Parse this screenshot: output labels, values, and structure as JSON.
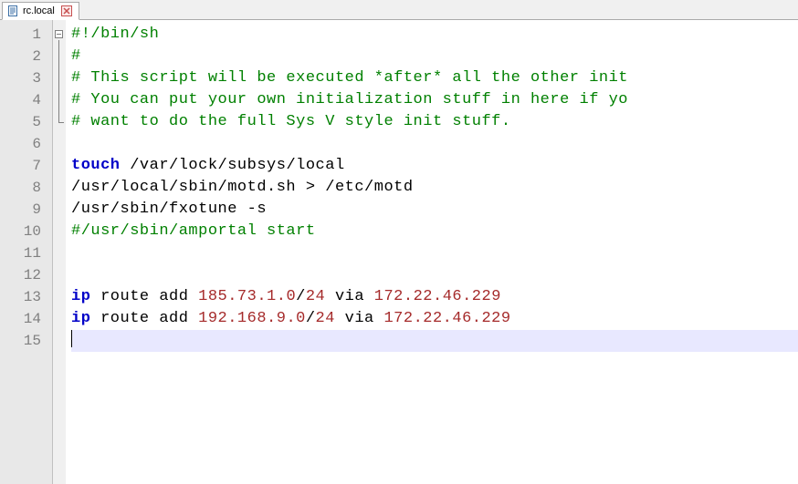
{
  "tab": {
    "filename": "rc.local"
  },
  "gutter": {
    "count": 15
  },
  "fold": {
    "start": 1,
    "end": 5
  },
  "code": {
    "lines": [
      [
        {
          "cls": "t-comment",
          "txt": "#!/bin/sh"
        }
      ],
      [
        {
          "cls": "t-comment",
          "txt": "#"
        }
      ],
      [
        {
          "cls": "t-comment",
          "txt": "# This script will be executed *after* all the other init"
        }
      ],
      [
        {
          "cls": "t-comment",
          "txt": "# You can put your own initialization stuff in here if yo"
        }
      ],
      [
        {
          "cls": "t-comment",
          "txt": "# want to do the full Sys V style init stuff."
        }
      ],
      [],
      [
        {
          "cls": "t-keyword",
          "txt": "touch"
        },
        {
          "cls": "t-plain",
          "txt": " /var/lock/subsys/local"
        }
      ],
      [
        {
          "cls": "t-plain",
          "txt": "/usr/local/sbin/motd.sh > /etc/motd"
        }
      ],
      [
        {
          "cls": "t-plain",
          "txt": "/usr/sbin/fxotune -s"
        }
      ],
      [
        {
          "cls": "t-comment",
          "txt": "#/usr/sbin/amportal start"
        }
      ],
      [],
      [],
      [
        {
          "cls": "t-keyword",
          "txt": "ip"
        },
        {
          "cls": "t-plain",
          "txt": " route add "
        },
        {
          "cls": "t-number",
          "txt": "185.73.1.0"
        },
        {
          "cls": "t-op",
          "txt": "/"
        },
        {
          "cls": "t-number",
          "txt": "24"
        },
        {
          "cls": "t-plain",
          "txt": " via "
        },
        {
          "cls": "t-number",
          "txt": "172.22.46.229"
        }
      ],
      [
        {
          "cls": "t-keyword",
          "txt": "ip"
        },
        {
          "cls": "t-plain",
          "txt": " route add "
        },
        {
          "cls": "t-number",
          "txt": "192.168.9.0"
        },
        {
          "cls": "t-op",
          "txt": "/"
        },
        {
          "cls": "t-number",
          "txt": "24"
        },
        {
          "cls": "t-plain",
          "txt": " via "
        },
        {
          "cls": "t-number",
          "txt": "172.22.46.229"
        }
      ],
      []
    ],
    "current_line": 15
  }
}
